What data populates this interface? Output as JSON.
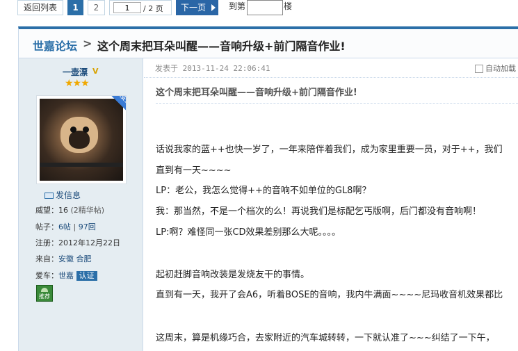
{
  "pager": {
    "back_label": "返回列表",
    "page1": "1",
    "page2": "2",
    "page_input_value": "1",
    "page_total": "/ 2 页",
    "next_label": "下一页",
    "goto_label": "到第",
    "goto_unit": "楼"
  },
  "thread": {
    "forum": "世嘉论坛",
    "separator": ">",
    "subject": "这个周末把耳朵叫醒——音响升级+前门隔音作业!"
  },
  "user": {
    "name": "一壶漂",
    "badge": "V",
    "stars": "★★★",
    "ribbon": "楼主",
    "send_message": "发信息",
    "rows": [
      {
        "label": "威望：",
        "value": "16",
        "extra": "(2精华帖)"
      },
      {
        "label": "帖子：",
        "value": "6帖",
        "sep": " | ",
        "value2": "97回"
      },
      {
        "label": "注册：",
        "value": "2012年12月22日"
      },
      {
        "label": "来自：",
        "value": "安徽 合肥"
      },
      {
        "label": "爱车：",
        "value": "世嘉",
        "cert": "认证"
      }
    ],
    "recommend_label": "推荐"
  },
  "post": {
    "posted_at": "发表于 2013-11-24 22:06:41",
    "autoload": "自动加载",
    "subject": "这个周末把耳朵叫醒——音响升级+前门隔音作业!",
    "lines": [
      "话说我家的蓝++也快一岁了，一年来陪伴着我们，成为家里重要一员，对于++，我们",
      "直到有一天~~~~",
      "LP：老公，我怎么觉得++的音响不如单位的GL8啊？",
      "我：那当然，不是一个档次的么！再说我们是标配乞丐版啊，后门都没有音响啊！",
      "LP:啊？难怪同一张CD效果差别那么大呢。。。。",
      "起初赶脚音响改装是发烧友干的事情。",
      "直到有一天，我开了会A6，听着BOSE的音响，我内牛满面~~~~尼玛收音机效果都比",
      "这周末，算是机缘巧合，去家附近的汽车城转转，一下就认准了~~~纠结了一下午，"
    ]
  }
}
